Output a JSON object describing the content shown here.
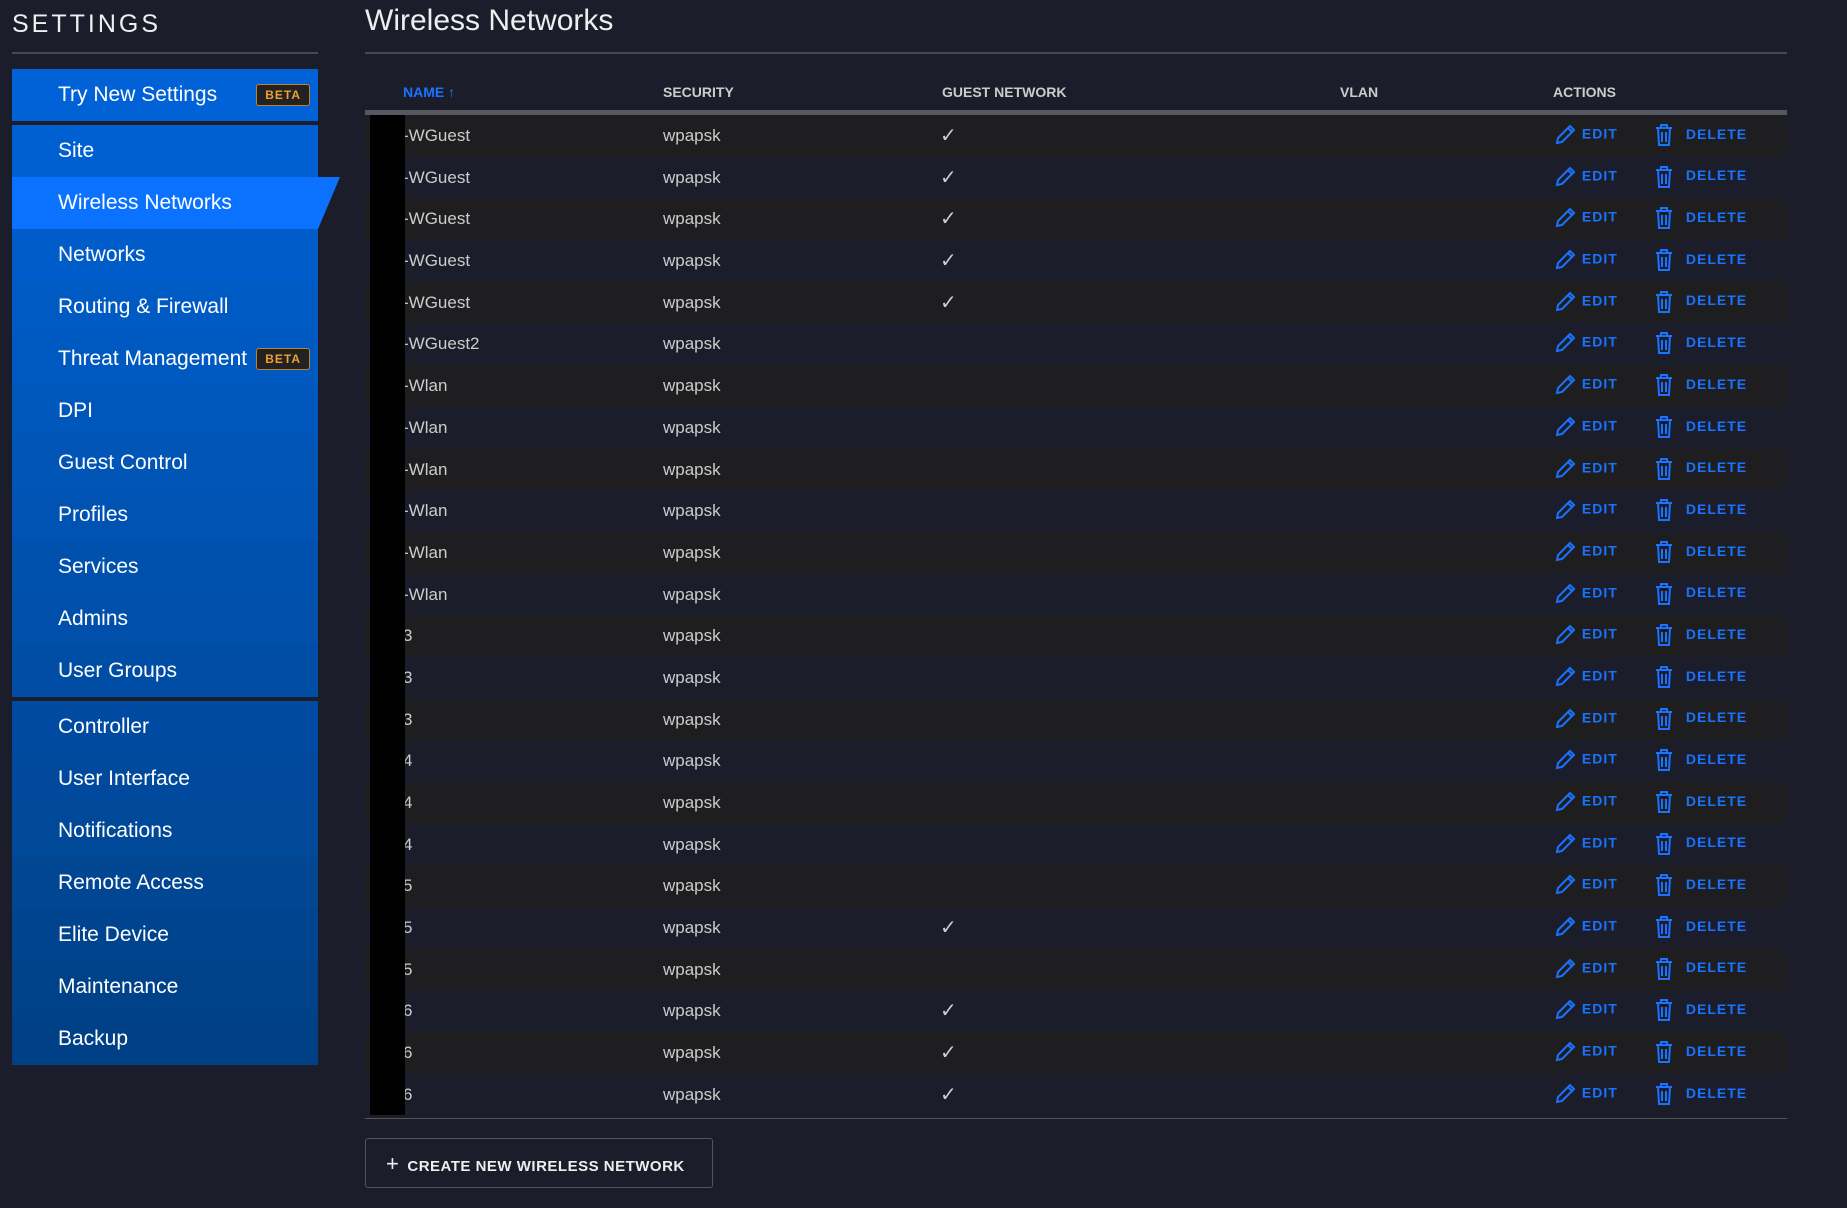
{
  "sidebar": {
    "title": "SETTINGS",
    "beta": "BETA",
    "items": [
      "Try New Settings",
      "Site",
      "Wireless Networks",
      "Networks",
      "Routing & Firewall",
      "Threat Management",
      "DPI",
      "Guest Control",
      "Profiles",
      "Services",
      "Admins",
      "User Groups",
      "Controller",
      "User Interface",
      "Notifications",
      "Remote Access",
      "Elite Device",
      "Maintenance",
      "Backup"
    ]
  },
  "main": {
    "title": "Wireless Networks",
    "columns": {
      "name": "NAME",
      "sort": "↑",
      "security": "SECURITY",
      "guest": "GUEST NETWORK",
      "vlan": "VLAN",
      "actions": "ACTIONS"
    },
    "edit": "EDIT",
    "delete": "DELETE",
    "check": "✓",
    "rows": [
      [
        "-WGuest",
        "wpapsk",
        true
      ],
      [
        "-WGuest",
        "wpapsk",
        true
      ],
      [
        "-WGuest",
        "wpapsk",
        true
      ],
      [
        "-WGuest",
        "wpapsk",
        true
      ],
      [
        "-WGuest",
        "wpapsk",
        true
      ],
      [
        "-WGuest2",
        "wpapsk",
        false
      ],
      [
        "-Wlan",
        "wpapsk",
        false
      ],
      [
        "-Wlan",
        "wpapsk",
        false
      ],
      [
        "-Wlan",
        "wpapsk",
        false
      ],
      [
        "-Wlan",
        "wpapsk",
        false
      ],
      [
        "-Wlan",
        "wpapsk",
        false
      ],
      [
        "-Wlan",
        "wpapsk",
        false
      ],
      [
        "3",
        "wpapsk",
        false
      ],
      [
        "3",
        "wpapsk",
        false
      ],
      [
        "3",
        "wpapsk",
        false
      ],
      [
        "4",
        "wpapsk",
        false
      ],
      [
        "4",
        "wpapsk",
        false
      ],
      [
        "4",
        "wpapsk",
        false
      ],
      [
        "5",
        "wpapsk",
        false
      ],
      [
        "5",
        "wpapsk",
        true
      ],
      [
        "5",
        "wpapsk",
        false
      ],
      [
        "6",
        "wpapsk",
        true
      ],
      [
        "6",
        "wpapsk",
        true
      ],
      [
        "6",
        "wpapsk",
        true
      ]
    ],
    "create_button": "CREATE NEW WIRELESS NETWORK"
  }
}
